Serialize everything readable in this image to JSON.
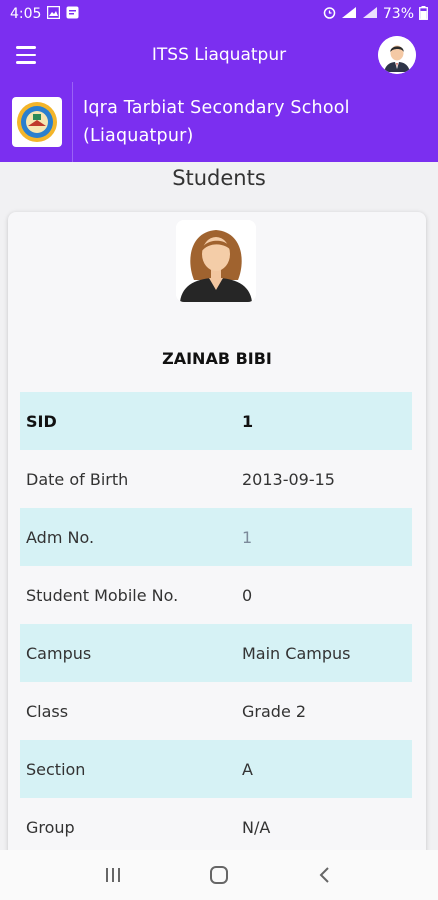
{
  "status_bar": {
    "time": "4:05",
    "battery": "73%"
  },
  "app_bar": {
    "title": "ITSS Liaquatpur",
    "menu_icon": "hamburger-menu-icon",
    "avatar_icon": "user-avatar-icon"
  },
  "school": {
    "name_line1": "Iqra Tarbiat Secondary School",
    "name_line2": "(Liaquatpur)",
    "logo_icon": "school-logo-icon"
  },
  "page": {
    "heading": "Students"
  },
  "student": {
    "name": "ZAINAB BIBI",
    "photo_icon": "student-photo-icon",
    "fields": [
      {
        "label": "SID",
        "value": "1"
      },
      {
        "label": "Date of Birth",
        "value": "2013-09-15"
      },
      {
        "label": "Adm No.",
        "value": "1"
      },
      {
        "label": "Student Mobile No.",
        "value": "0"
      },
      {
        "label": "Campus",
        "value": "Main Campus"
      },
      {
        "label": "Class",
        "value": "Grade 2"
      },
      {
        "label": "Section",
        "value": "A"
      },
      {
        "label": "Group",
        "value": "N/A"
      }
    ]
  },
  "colors": {
    "primary": "#7b2ff0",
    "row_highlight": "#d6f2f5"
  },
  "nav_bar": {
    "recents_icon": "recents-icon",
    "home_icon": "home-icon",
    "back_icon": "back-icon"
  }
}
